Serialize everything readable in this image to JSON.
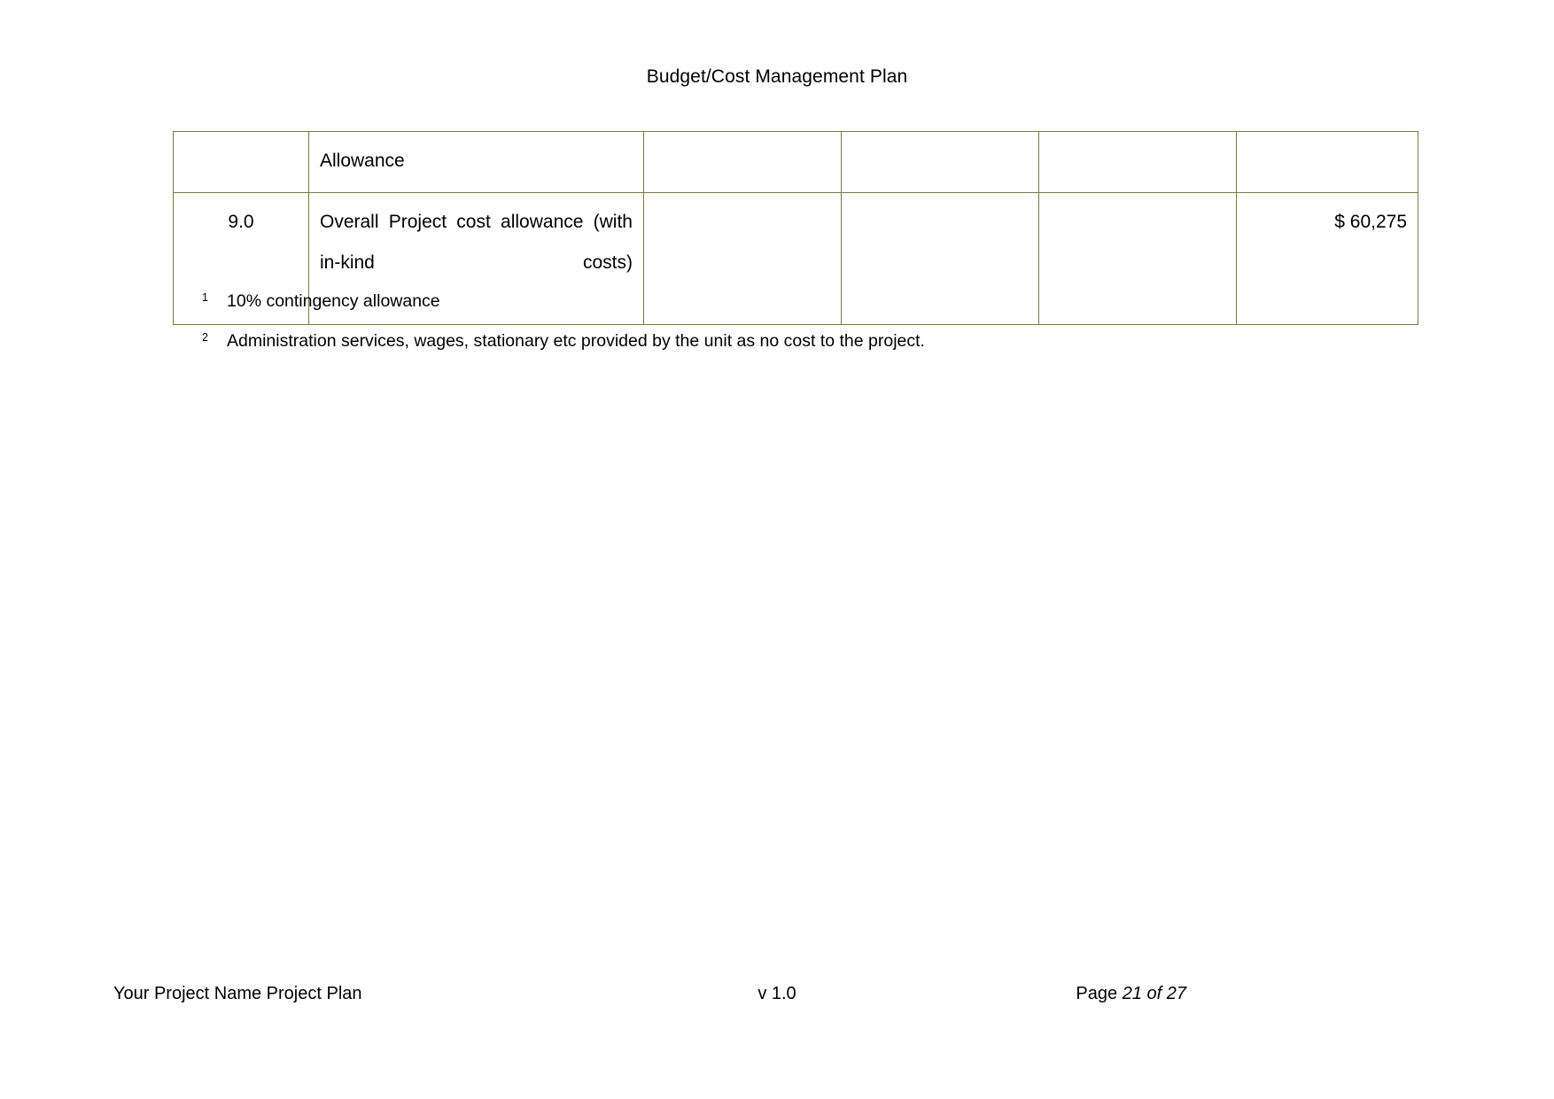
{
  "document": {
    "header_title": "Budget/Cost Management Plan"
  },
  "table": {
    "columns": [
      "",
      "",
      "",
      "",
      "",
      ""
    ],
    "rows": [
      {
        "num": "",
        "description": "Allowance",
        "col3": "",
        "col4": "",
        "col5": "",
        "amount": ""
      },
      {
        "num": "9.0",
        "description": "Overall Project cost allowance (with in-kind costs)",
        "col3": "",
        "col4": "",
        "col5": "",
        "amount": "$ 60,275"
      }
    ]
  },
  "footnotes": [
    {
      "marker": "1",
      "text": "10% contingency allowance"
    },
    {
      "marker": "2",
      "text": "Administration services, wages, stationary etc provided by the unit as no cost to the project."
    }
  ],
  "footer": {
    "left": "Your Project Name Project Plan",
    "center": "v 1.0",
    "page_label": "Page",
    "page_value": "21 of 27"
  },
  "colors": {
    "table_border": "#7c7c3f",
    "text": "#000000",
    "page_background": "#ffffff"
  }
}
